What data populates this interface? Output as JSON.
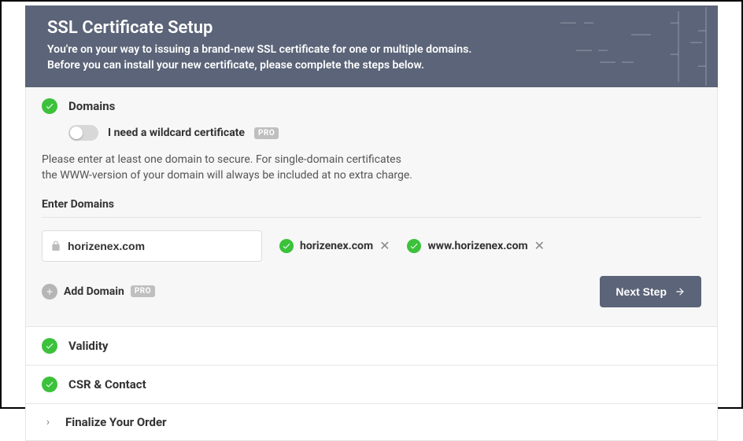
{
  "header": {
    "title": "SSL Certificate Setup",
    "subtitle_line1": "You're on your way to issuing a brand-new SSL certificate for one or multiple domains.",
    "subtitle_line2": "Before you can install your new certificate, please complete the steps below."
  },
  "steps": {
    "domains": {
      "title": "Domains",
      "wildcard_toggle_label": "I need a wildcard certificate",
      "pro_badge": "PRO",
      "instruction_line1": "Please enter at least one domain to secure. For single-domain certificates",
      "instruction_line2": "the WWW-version of your domain will always be included at no extra charge.",
      "enter_label": "Enter Domains",
      "input_value": "horizenex.com",
      "chips": [
        {
          "domain": "horizenex.com"
        },
        {
          "domain": "www.horizenex.com"
        }
      ],
      "add_domain_label": "Add Domain",
      "next_step_label": "Next Step"
    },
    "validity": {
      "title": "Validity"
    },
    "csr": {
      "title": "CSR & Contact"
    },
    "finalize": {
      "title": "Finalize Your Order"
    }
  }
}
